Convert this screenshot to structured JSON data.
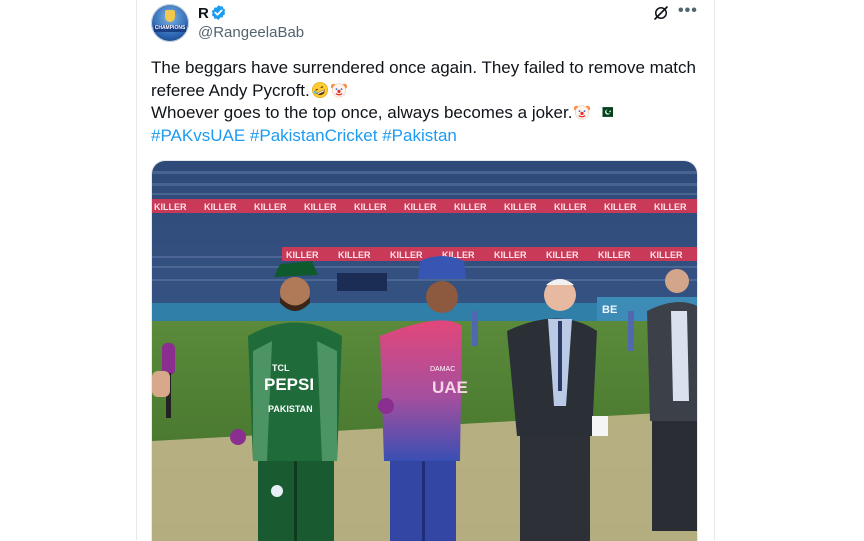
{
  "author": {
    "name": "R",
    "handle": "@RangeelaBab",
    "avatar_text": "CHAMPIONS"
  },
  "tweet": {
    "line1": "The beggars have surrendered once again. They failed to remove match",
    "line2": "referee Andy Pycroft.",
    "line3": "Whoever goes to the top once, always becomes a joker.",
    "hashtags": [
      "#PAKvsUAE",
      "#PakistanCricket",
      "#Pakistan"
    ]
  },
  "media": {
    "board_text": "KILLER",
    "left_jersey_brand": "TCL",
    "left_jersey_sponsor": "PEPSI",
    "left_jersey_country": "PAKISTAN",
    "right_jersey_brand": "DAMAC",
    "right_jersey_country": "UAE",
    "billboard_text": "BE"
  },
  "colors": {
    "accent": "#1d9bf0",
    "text": "#0f1419",
    "secondary": "#536471"
  },
  "icons": [
    "verified-badge-icon",
    "grok-icon",
    "more-icon",
    "rofl-emoji-icon",
    "clown-emoji-icon",
    "pakistan-flag-icon"
  ]
}
